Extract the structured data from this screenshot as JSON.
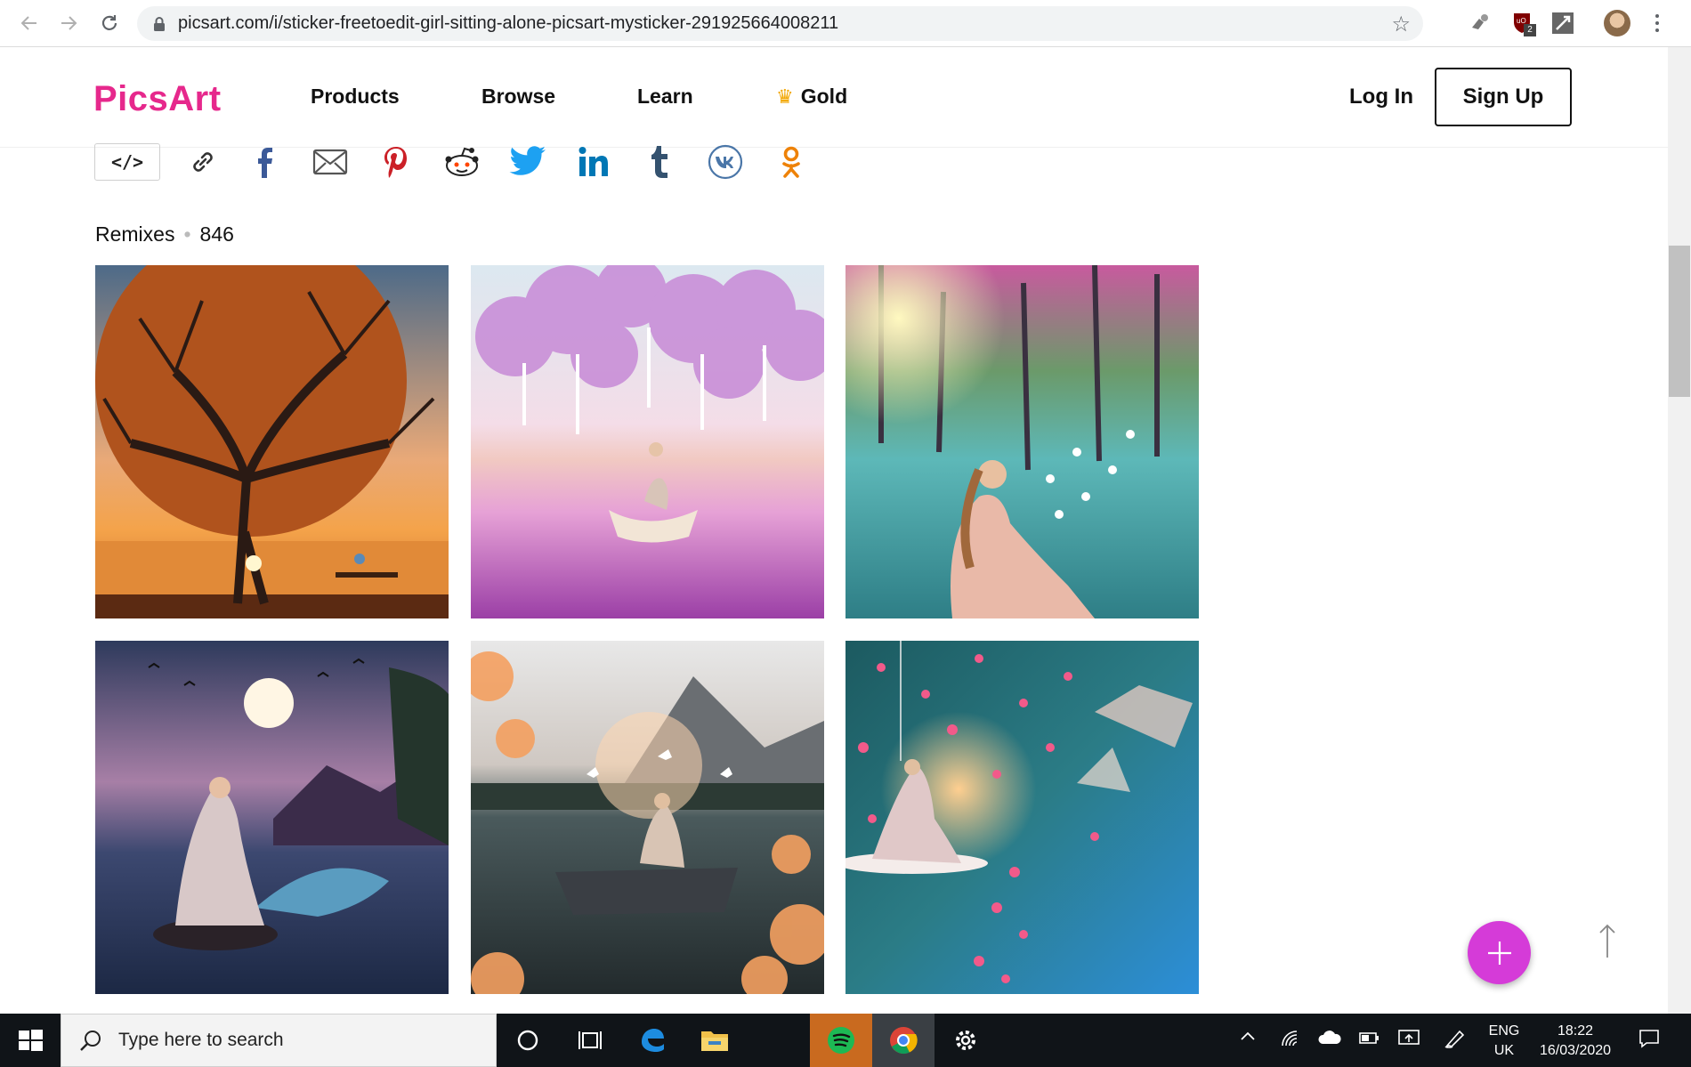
{
  "browser": {
    "url": "picsart.com/i/sticker-freetoedit-girl-sitting-alone-picsart-mysticker-291925664008211",
    "extension_badge": "2"
  },
  "header": {
    "logo": "PicsArt",
    "nav": [
      {
        "label": "Products"
      },
      {
        "label": "Browse"
      },
      {
        "label": "Learn"
      },
      {
        "label": "Gold"
      }
    ],
    "login_label": "Log In",
    "signup_label": "Sign Up"
  },
  "share": {
    "embed_label": "</>",
    "icons": [
      "link-icon",
      "facebook-icon",
      "email-icon",
      "pinterest-icon",
      "reddit-icon",
      "twitter-icon",
      "linkedin-icon",
      "tumblr-icon",
      "vk-icon",
      "odnoklassniki-icon"
    ],
    "colors": {
      "facebook": "#3b5998",
      "pinterest": "#cb2027",
      "reddit": "#ff4500",
      "twitter": "#1da1f2",
      "linkedin": "#0077b5",
      "tumblr": "#34526f",
      "vk": "#4a76a8",
      "ok": "#ee8208"
    }
  },
  "remixes": {
    "label": "Remixes",
    "count": "846",
    "tiles": [
      {
        "name": "tree-moon-sunset"
      },
      {
        "name": "pink-trees-boat"
      },
      {
        "name": "forest-lake-butterflies"
      },
      {
        "name": "moon-night-sea"
      },
      {
        "name": "mountain-lake-boat-doves"
      },
      {
        "name": "rose-petals-teal"
      }
    ]
  },
  "taskbar": {
    "search_placeholder": "Type here to search",
    "lang_top": "ENG",
    "lang_bottom": "UK",
    "time": "18:22",
    "date": "16/03/2020"
  },
  "accent_color": "#e6288c",
  "fab_color": "#d53bd8"
}
